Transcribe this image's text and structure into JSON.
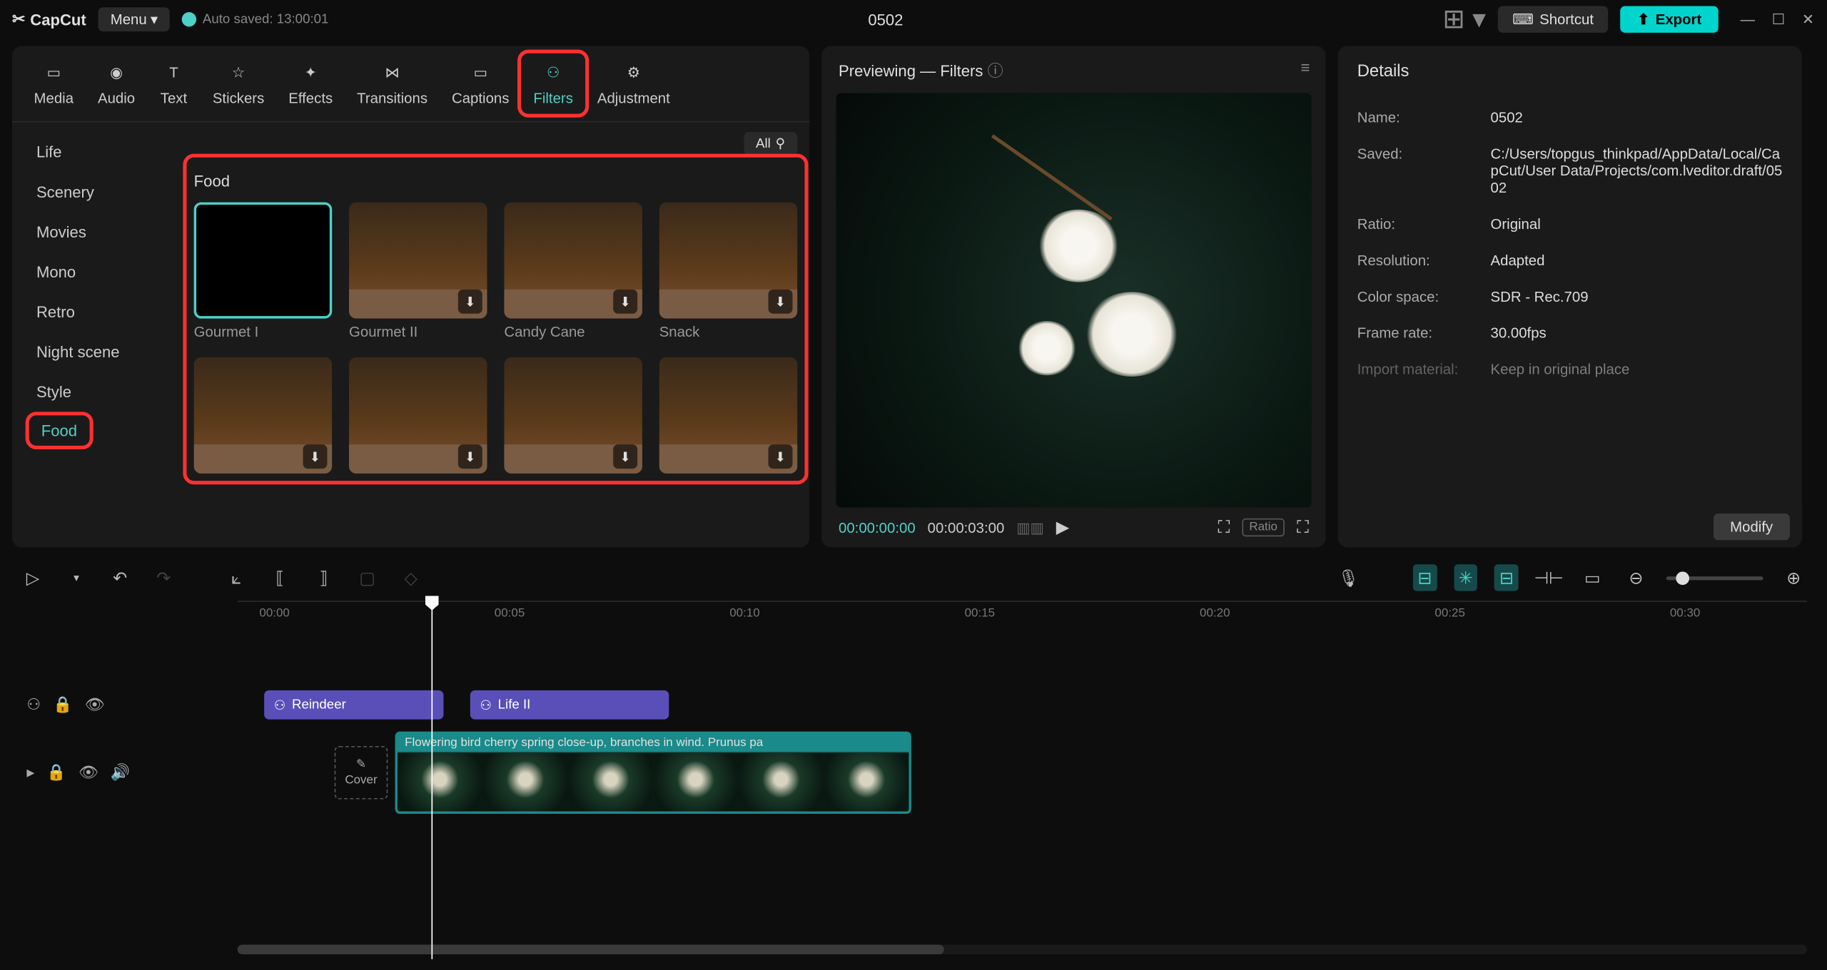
{
  "app": {
    "name": "CapCut",
    "menuLabel": "Menu",
    "autoSave": "Auto saved: 13:00:01",
    "projectTitle": "0502"
  },
  "titlebar": {
    "shortcut": "Shortcut",
    "export": "Export"
  },
  "topTabs": [
    "Media",
    "Audio",
    "Text",
    "Stickers",
    "Effects",
    "Transitions",
    "Captions",
    "Filters",
    "Adjustment"
  ],
  "activeTopTab": "Filters",
  "sidebarCats": [
    "Life",
    "Scenery",
    "Movies",
    "Mono",
    "Retro",
    "Night scene",
    "Style",
    "Food"
  ],
  "activeCat": "Food",
  "filterHeader": {
    "all": "All"
  },
  "filterSection": "Food",
  "filters": [
    {
      "label": "Gourmet I",
      "selected": true
    },
    {
      "label": "Gourmet II"
    },
    {
      "label": "Candy Cane"
    },
    {
      "label": "Snack"
    },
    {
      "label": ""
    },
    {
      "label": ""
    },
    {
      "label": ""
    },
    {
      "label": ""
    }
  ],
  "preview": {
    "title": "Previewing — Filters",
    "timeCurrent": "00:00:00:00",
    "timeTotal": "00:00:03:00",
    "ratio": "Ratio"
  },
  "details": {
    "title": "Details",
    "rows": [
      {
        "k": "Name:",
        "v": "0502"
      },
      {
        "k": "Saved:",
        "v": "C:/Users/topgus_thinkpad/AppData/Local/CapCut/User Data/Projects/com.lveditor.draft/0502"
      },
      {
        "k": "Ratio:",
        "v": "Original"
      },
      {
        "k": "Resolution:",
        "v": "Adapted"
      },
      {
        "k": "Color space:",
        "v": "SDR - Rec.709"
      },
      {
        "k": "Frame rate:",
        "v": "30.00fps"
      },
      {
        "k": "Import material:",
        "v": "Keep in original place"
      }
    ],
    "modify": "Modify"
  },
  "ruler": [
    "00:00",
    "00:05",
    "00:10",
    "00:15",
    "00:20",
    "00:25",
    "00:30"
  ],
  "clips": {
    "filter1": "Reindeer",
    "filter2": "Life II",
    "video": "Flowering bird cherry spring close-up, branches in wind. Prunus pa",
    "cover": "Cover"
  }
}
